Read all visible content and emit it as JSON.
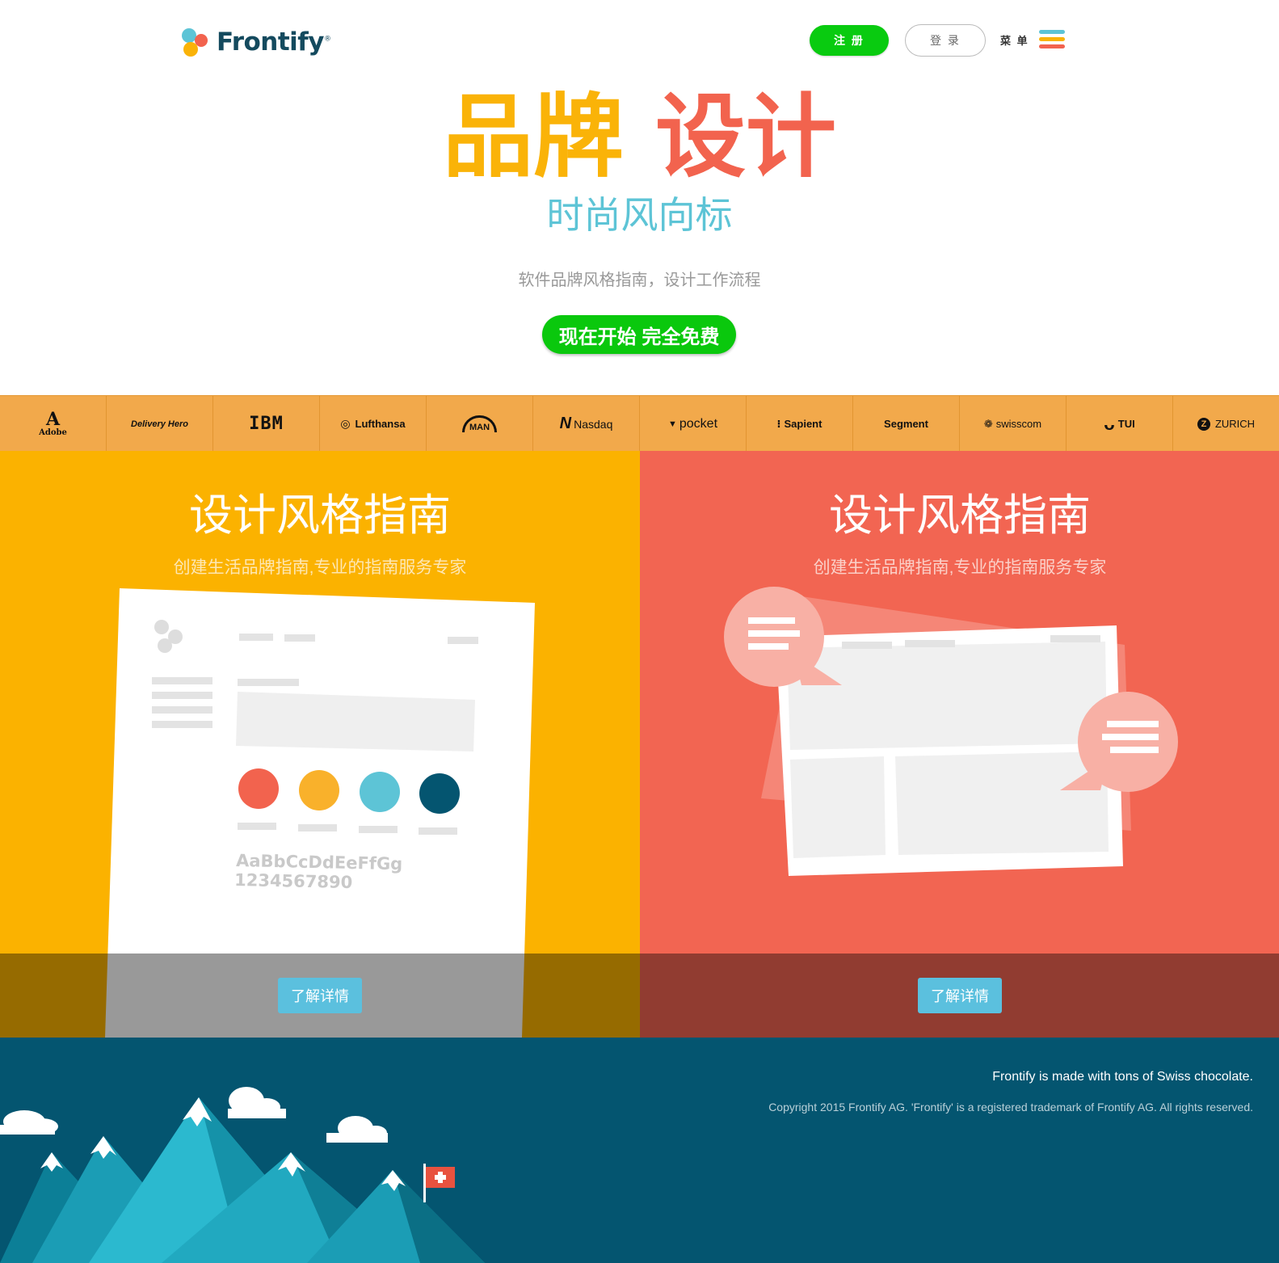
{
  "header": {
    "brand": "Frontify",
    "brand_mark": "®",
    "register_label": "注 册",
    "login_label": "登 录",
    "menu_label": "菜 单",
    "menu_icon_colors": [
      "#5dc4d6",
      "#fab308",
      "#f2634e"
    ]
  },
  "hero": {
    "title_part1": "品牌",
    "title_part2": "设计",
    "subtitle": "时尚风向标",
    "description": "软件品牌风格指南，设计工作流程",
    "cta_label": "现在开始 完全免费"
  },
  "clients": [
    "Adobe",
    "Delivery Hero",
    "IBM",
    "Lufthansa",
    "MAN",
    "Nasdaq",
    "pocket",
    "Sapient",
    "Segment",
    "swisscom",
    "TUI",
    "ZURICH"
  ],
  "panels": [
    {
      "title": "设计风格指南",
      "subtitle": "创建生活品牌指南,专业的指南服务专家",
      "button": "了解详情",
      "sample_letters": "AaBbCcDdEeFfGg",
      "sample_numbers": "1234567890",
      "swatches": [
        "#f2634e",
        "#f9b12b",
        "#5dc4d6",
        "#045570"
      ]
    },
    {
      "title": "设计风格指南",
      "subtitle": "创建生活品牌指南,专业的指南服务专家",
      "button": "了解详情"
    }
  ],
  "footer": {
    "tagline": "Frontify is made with tons of Swiss chocolate.",
    "copyright": "Copyright 2015 Frontify AG. 'Frontify' is a registered trademark of Frontify AG. All rights reserved."
  },
  "colors": {
    "yellow": "#fbb200",
    "red": "#f26552",
    "green": "#09cb10",
    "teal": "#5dc4d6",
    "navy": "#045570",
    "strip": "#f2a94b"
  }
}
